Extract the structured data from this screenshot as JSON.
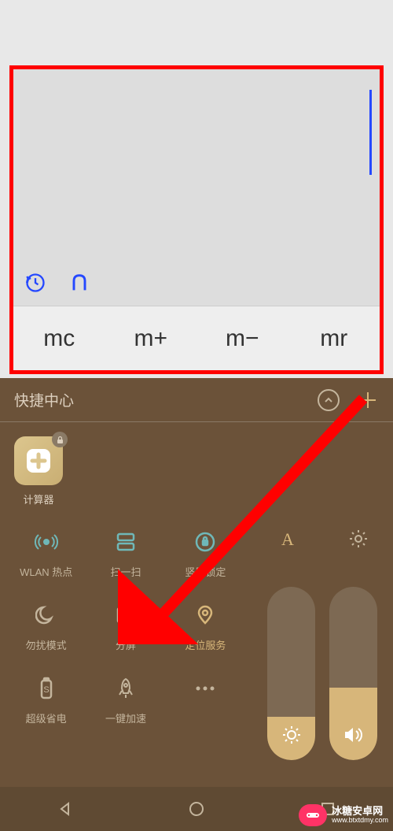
{
  "calculator": {
    "memory_buttons": [
      "mc",
      "m+",
      "m−",
      "mr"
    ]
  },
  "control_panel": {
    "title": "快捷中心",
    "app_dock": {
      "label": "计算器"
    },
    "toggles": [
      [
        {
          "label": "WLAN 热点",
          "active": false
        },
        {
          "label": "扫一扫",
          "active": false
        },
        {
          "label": "竖屏锁定",
          "active": false
        }
      ],
      [
        {
          "label": "勿扰模式",
          "active": false
        },
        {
          "label": "分屏",
          "active": false
        },
        {
          "label": "定位服务",
          "active": true
        }
      ],
      [
        {
          "label": "超级省电",
          "active": false
        },
        {
          "label": "一键加速",
          "active": false
        },
        {
          "label": "",
          "active": false
        }
      ]
    ],
    "sliders": {
      "brightness_percent": 25,
      "volume_percent": 42
    }
  },
  "watermark": {
    "name": "冰糖安卓网",
    "url": "www.btxtdmy.com"
  },
  "colors": {
    "panel_bg": "#6b5239",
    "accent": "#d7b67a",
    "muted_text": "#c4b59d",
    "annotation_red": "#ff0000"
  }
}
